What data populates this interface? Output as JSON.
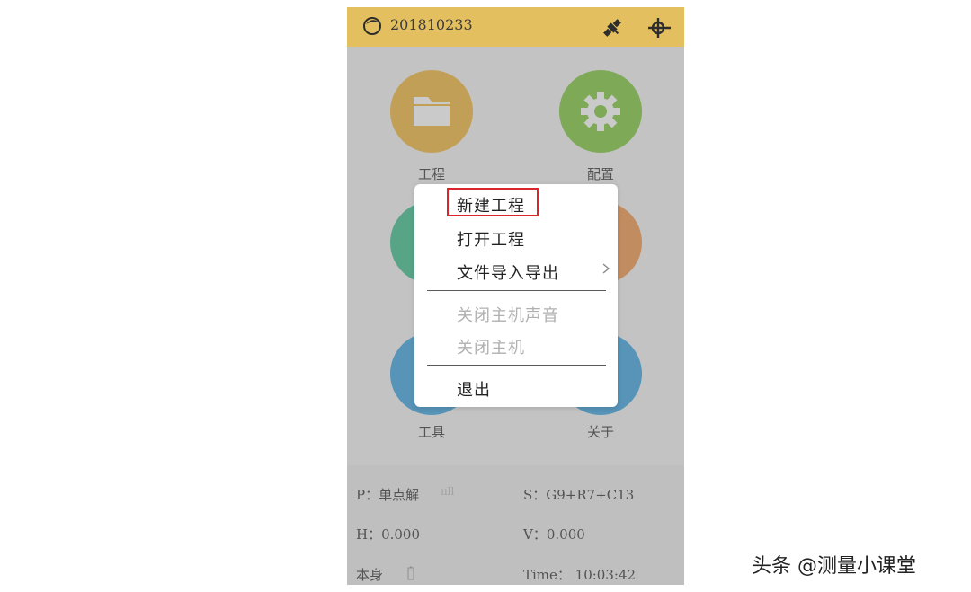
{
  "header": {
    "device_id": "201810233"
  },
  "tiles": [
    {
      "label": "工程",
      "color": "#f2b53a",
      "icon": "folder-icon"
    },
    {
      "label": "配置",
      "color": "#7cc63a",
      "icon": "gear-icon"
    },
    {
      "label": "",
      "color": "#3bbd8c",
      "icon": ""
    },
    {
      "label": "",
      "color": "#f2944a",
      "icon": ""
    },
    {
      "label": "工具",
      "color": "#3aa3e0",
      "icon": ""
    },
    {
      "label": "关于",
      "color": "#3aa3e0",
      "icon": ""
    }
  ],
  "status": {
    "p_label": "P：单点解",
    "p_suffix": "ııll",
    "s_value": "S：G9+R7+C13",
    "h_value": "H：0.000",
    "v_value": "V：0.000",
    "mode": "本身",
    "time": "Time： 10:03:42"
  },
  "menu": {
    "items": [
      {
        "label": "新建工程",
        "enabled": true,
        "highlighted": true
      },
      {
        "label": "打开工程",
        "enabled": true
      },
      {
        "label": "文件导入导出",
        "enabled": true,
        "submenu": true
      },
      {
        "label": "关闭主机声音",
        "enabled": false
      },
      {
        "label": "关闭主机",
        "enabled": false
      },
      {
        "label": "退出",
        "enabled": true
      }
    ]
  },
  "watermark": "头条 @测量小课堂",
  "colors": {
    "header": "#f2c85a",
    "highlight": "#d8262c"
  }
}
